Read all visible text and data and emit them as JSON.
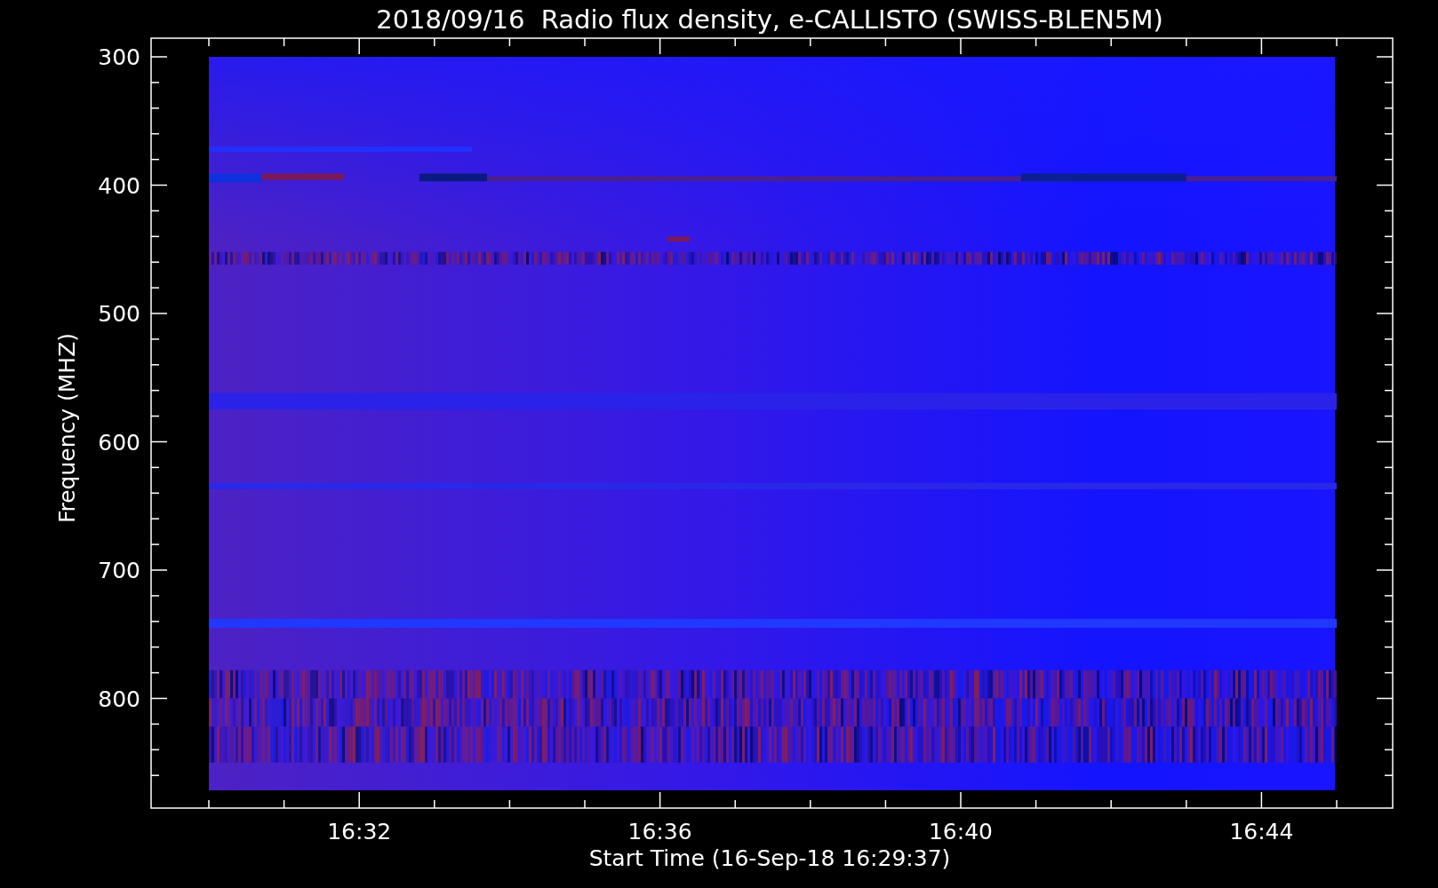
{
  "title": "2018/09/16  Radio flux density, e-CALLISTO (SWISS-BLEN5M)",
  "y_axis": {
    "label": "Frequency (MHZ)",
    "ticks": [
      "300",
      "400",
      "500",
      "600",
      "700",
      "800"
    ]
  },
  "x_axis": {
    "label": "Start Time (16-Sep-18 16:29:37)",
    "ticks": [
      "16:32",
      "16:36",
      "16:40",
      "16:44"
    ]
  }
}
